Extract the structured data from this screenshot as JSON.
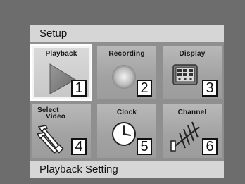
{
  "menu": {
    "title": "Setup",
    "status": "Playback Setting"
  },
  "tiles": [
    {
      "label": "Playback",
      "number": "1",
      "icon": "play-triangle-icon",
      "selected": true
    },
    {
      "label": "Recording",
      "number": "2",
      "icon": "record-circle-icon",
      "selected": false
    },
    {
      "label": "Display",
      "number": "3",
      "icon": "display-keypad-icon",
      "selected": false
    },
    {
      "label_line1": "Select",
      "label_line2": "Video",
      "number": "4",
      "icon": "av-cable-icon",
      "selected": false
    },
    {
      "label": "Clock",
      "number": "5",
      "icon": "clock-icon",
      "selected": false
    },
    {
      "label": "Channel",
      "number": "6",
      "icon": "antenna-icon",
      "selected": false
    }
  ],
  "colors": {
    "background": "#6d6d6d",
    "bar": "#d6d6d6",
    "selected_outline": "#ffffff"
  }
}
